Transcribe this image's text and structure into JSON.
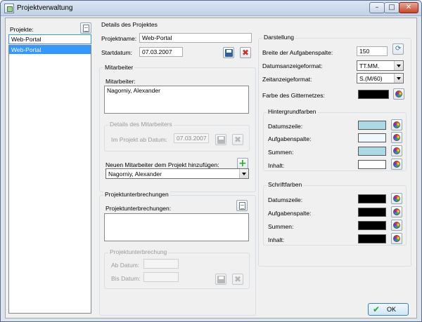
{
  "window": {
    "title": "Projektverwaltung",
    "minimize": "–",
    "maximize": "□",
    "close": "✕"
  },
  "projects": {
    "label": "Projekte:",
    "input_value": "Web-Portal",
    "items": [
      "Web-Portal"
    ]
  },
  "details": {
    "group_title": "Details des Projektes",
    "name_label": "Projektname:",
    "name_value": "Web-Portal",
    "start_label": "Startdatum:",
    "start_value": "07.03.2007"
  },
  "staff": {
    "group_title": "Mitarbeiter",
    "list_label": "Mitarbeiter:",
    "items": [
      "Nagorniy, Alexander"
    ],
    "details_group_title": "Details des Mitarbeiters",
    "since_label": "Im Projekt ab Datum:",
    "since_value": "07.03.2007",
    "add_label": "Neuen Mitarbeiter dem Projekt hinzufügen:",
    "add_selected": "Nagorniy, Alexander"
  },
  "breaks": {
    "group_title": "Projektunterbrechungen",
    "list_label": "Projektunterbrechungen:",
    "detail_group_title": "Projektunterbrechung",
    "from_label": "Ab Datum:",
    "to_label": "Bis Datum:",
    "from_value": "",
    "to_value": ""
  },
  "display": {
    "group_title": "Darstellung",
    "width_label": "Breite der Aufgabenspalte:",
    "width_value": "150",
    "date_format_label": "Datumsanzeigeformat:",
    "date_format_value": "TT.MM.",
    "time_format_label": "Zeitanzeigeformat:",
    "time_format_value": "S.(M/60)",
    "grid_color_label": "Farbe des Gitternetzes:",
    "grid_color": "#000000",
    "bg_group_title": "Hintergrundfarben",
    "bg": [
      {
        "label": "Datumszeile:",
        "color": "#add8e6"
      },
      {
        "label": "Aufgabenspalte:",
        "color": "#f0f8ff"
      },
      {
        "label": "Summen:",
        "color": "#add8e6"
      },
      {
        "label": "Inhalt:",
        "color": "#ffffff"
      }
    ],
    "font_group_title": "Schriftfarben",
    "font": [
      {
        "label": "Datumszeile:",
        "color": "#000000"
      },
      {
        "label": "Aufgabenspalte:",
        "color": "#000000"
      },
      {
        "label": "Summen:",
        "color": "#000000"
      },
      {
        "label": "Inhalt:",
        "color": "#000000"
      }
    ]
  },
  "ok_label": "OK"
}
